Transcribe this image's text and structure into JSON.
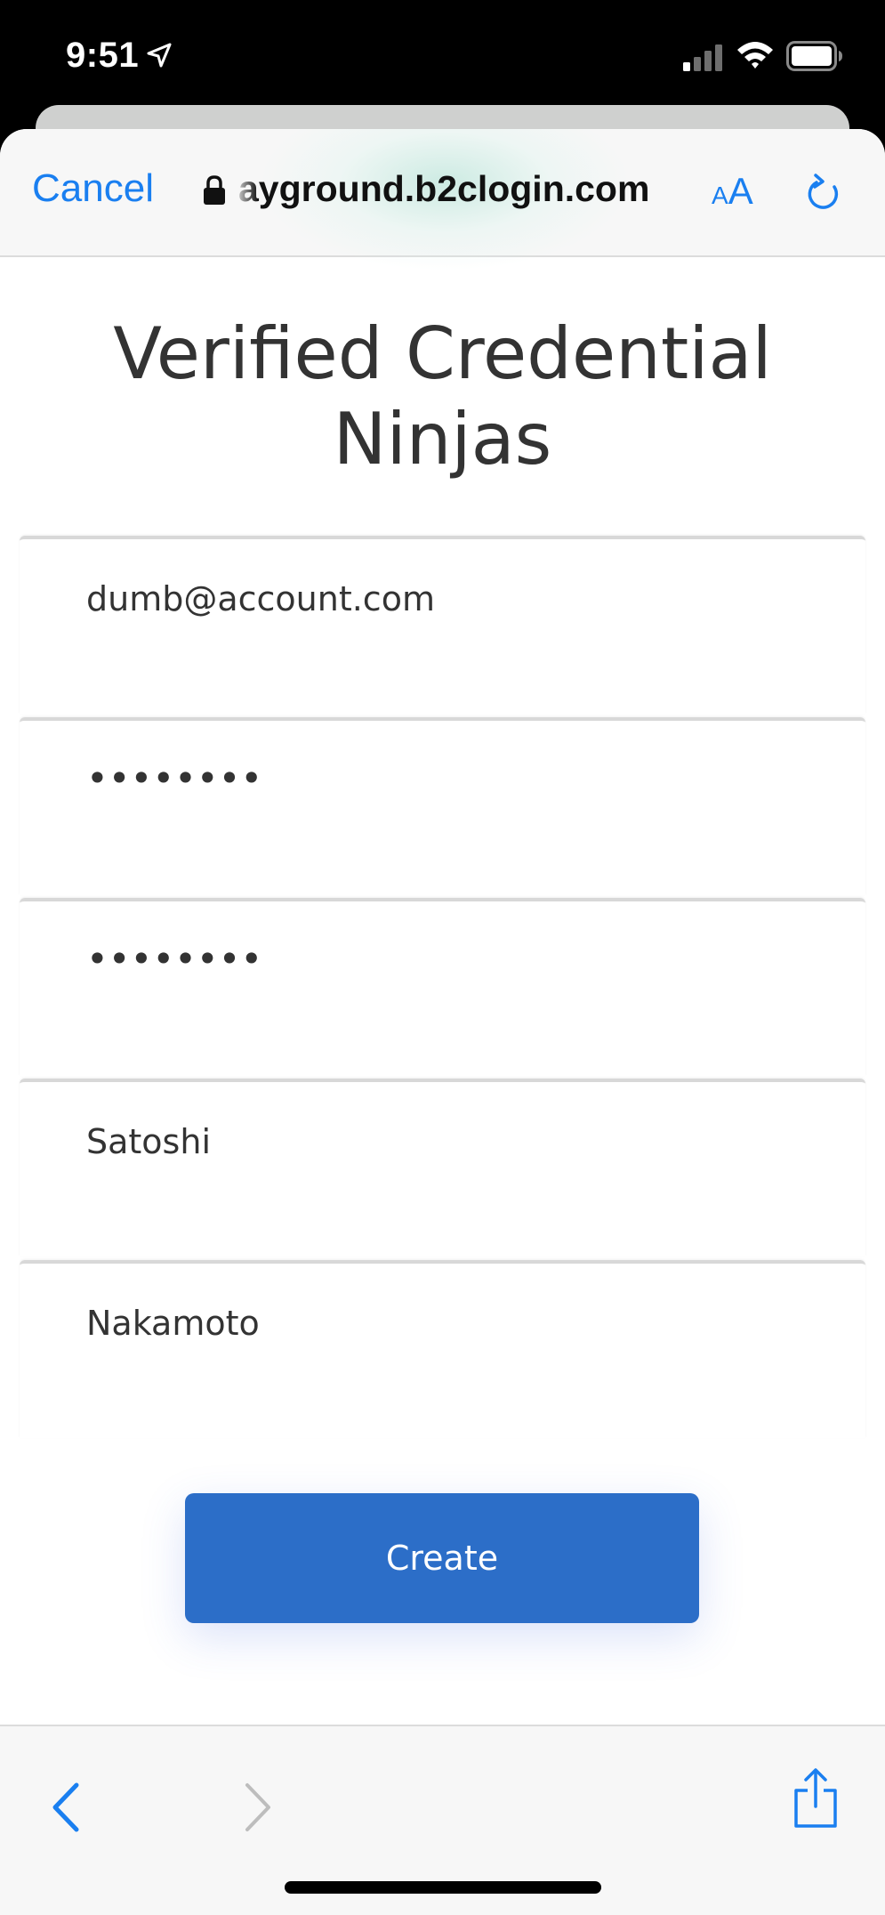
{
  "status_bar": {
    "time": "9:51"
  },
  "browser": {
    "cancel_label": "Cancel",
    "url": "ayground.b2clogin.com",
    "text_size_small": "A",
    "text_size_large": "A"
  },
  "page": {
    "title_line1": "Verified Credential",
    "title_line2": "Ninjas",
    "fields": [
      {
        "value": "dumb@account.com"
      },
      {
        "value": "••••••••"
      },
      {
        "value": "••••••••"
      },
      {
        "value": "Satoshi"
      },
      {
        "value": "Nakamoto"
      }
    ],
    "create_label": "Create"
  },
  "icons": {
    "location": "location-arrow-icon",
    "signal": "cellular-signal-icon",
    "wifi": "wifi-icon",
    "battery": "battery-icon",
    "lock": "lock-icon",
    "reload": "reload-icon",
    "back": "chevron-left-icon",
    "forward": "chevron-right-icon",
    "share": "share-icon"
  },
  "colors": {
    "accent": "#1a7ff0",
    "button": "#2c6ec8",
    "text": "#333333"
  }
}
